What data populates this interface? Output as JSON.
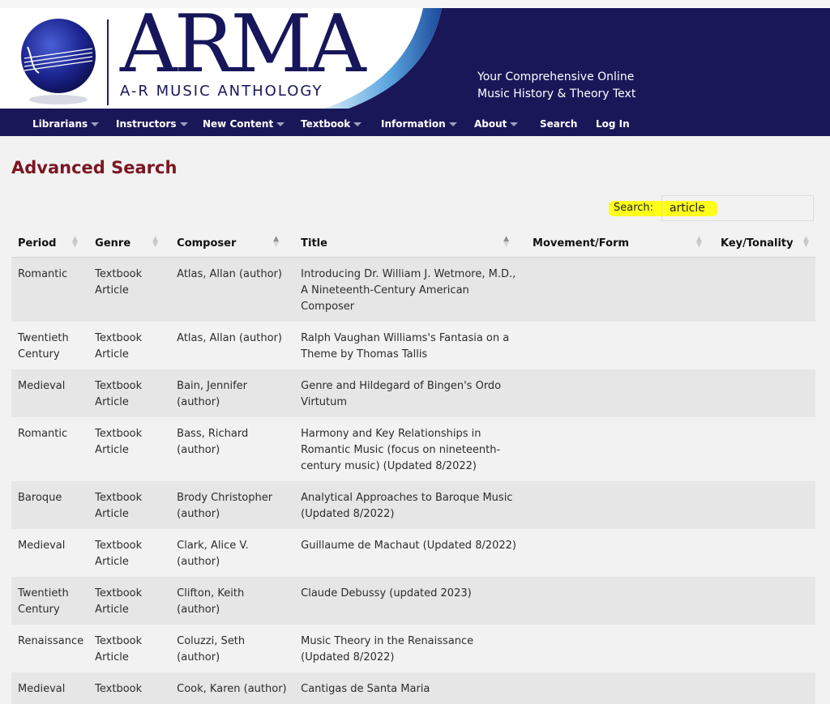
{
  "header": {
    "logo_word": "ARMA",
    "logo_subtitle": "A-R MUSIC ANTHOLOGY",
    "tagline_line1": "Your Comprehensive Online",
    "tagline_line2": "Music History & Theory Text",
    "colors": {
      "navy": "#1a1759",
      "accent_blue": "#3a8fd3"
    }
  },
  "nav": {
    "librarians": "Librarians",
    "instructors": "Instructors",
    "new_content": "New Content",
    "textbook": "Textbook",
    "information": "Information",
    "about": "About",
    "search": "Search",
    "login": "Log In"
  },
  "page": {
    "title": "Advanced Search",
    "title_color": "#7b1622"
  },
  "search": {
    "label": "Search:",
    "value": "article"
  },
  "table": {
    "headers": {
      "period": "Period",
      "genre": "Genre",
      "composer": "Composer",
      "title": "Title",
      "movement": "Movement/Form",
      "key": "Key/Tonality"
    },
    "rows": [
      {
        "period": "Romantic",
        "genre": "Textbook Article",
        "composer": "Atlas, Allan (author)",
        "title": "Introducing Dr. William J. Wetmore, M.D., A Nineteenth-Century American Composer",
        "movement": "",
        "key": ""
      },
      {
        "period": "Twentieth Century",
        "genre": "Textbook Article",
        "composer": "Atlas, Allan (author)",
        "title": "Ralph Vaughan Williams's Fantasia on a Theme by Thomas Tallis",
        "movement": "",
        "key": ""
      },
      {
        "period": "Medieval",
        "genre": "Textbook Article",
        "composer": "Bain, Jennifer (author)",
        "title": "Genre and Hildegard of Bingen's Ordo Virtutum",
        "movement": "",
        "key": ""
      },
      {
        "period": "Romantic",
        "genre": "Textbook Article",
        "composer": "Bass, Richard (author)",
        "title": "Harmony and Key Relationships in Romantic Music (focus on nineteenth-century music) (Updated 8/2022)",
        "movement": "",
        "key": ""
      },
      {
        "period": "Baroque",
        "genre": "Textbook Article",
        "composer": "Brody Christopher (author)",
        "title": "Analytical Approaches to Baroque Music (Updated 8/2022)",
        "movement": "",
        "key": ""
      },
      {
        "period": "Medieval",
        "genre": "Textbook Article",
        "composer": "Clark, Alice V. (author)",
        "title": "Guillaume de Machaut (Updated 8/2022)",
        "movement": "",
        "key": ""
      },
      {
        "period": "Twentieth Century",
        "genre": "Textbook Article",
        "composer": "Clifton, Keith (author)",
        "title": "Claude Debussy (updated 2023)",
        "movement": "",
        "key": ""
      },
      {
        "period": "Renaissance",
        "genre": "Textbook Article",
        "composer": "Coluzzi, Seth (author)",
        "title": "Music Theory in the Renaissance (Updated 8/2022)",
        "movement": "",
        "key": ""
      },
      {
        "period": "Medieval",
        "genre": "Textbook",
        "composer": "Cook, Karen (author)",
        "title": "Cantigas de Santa Maria",
        "movement": "",
        "key": ""
      }
    ]
  }
}
